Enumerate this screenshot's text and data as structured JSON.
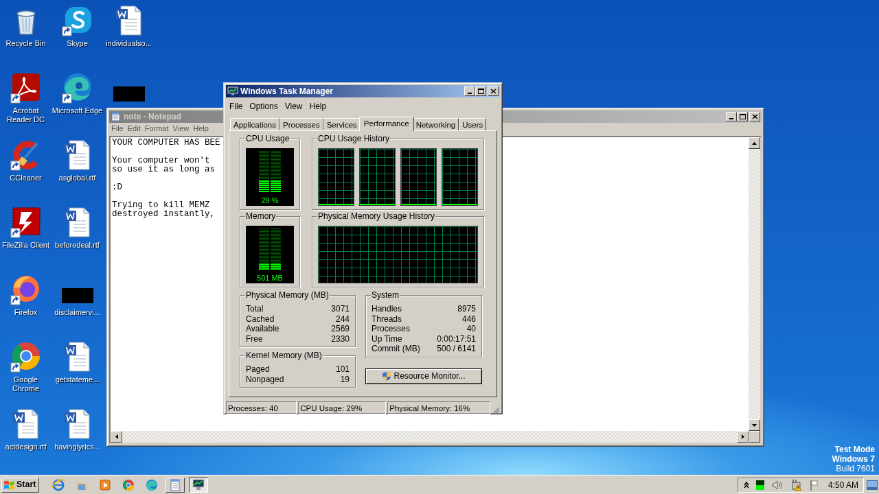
{
  "desktop": {
    "icons": [
      {
        "label": "Recycle Bin",
        "kind": "recycle",
        "shortcut": false
      },
      {
        "label": "Acrobat Reader DC",
        "kind": "acrobat",
        "shortcut": true
      },
      {
        "label": "CCleaner",
        "kind": "ccleaner",
        "shortcut": true
      },
      {
        "label": "FileZilla Client",
        "kind": "filezilla",
        "shortcut": true
      },
      {
        "label": "Firefox",
        "kind": "firefox",
        "shortcut": true
      },
      {
        "label": "Google Chrome",
        "kind": "chrome",
        "shortcut": true
      },
      {
        "label": "actdesign.rtf",
        "kind": "document",
        "shortcut": false
      },
      {
        "label": "Skype",
        "kind": "skype",
        "shortcut": true
      },
      {
        "label": "Microsoft Edge",
        "kind": "edge",
        "shortcut": true
      },
      {
        "label": "asglobal.rtf",
        "kind": "document",
        "shortcut": false
      },
      {
        "label": "beforedeal.rtf",
        "kind": "document",
        "shortcut": false
      },
      {
        "label": "disclaimervi...",
        "kind": "blacked_out",
        "shortcut": false
      },
      {
        "label": "getstateme...",
        "kind": "document",
        "shortcut": false
      },
      {
        "label": "havinglyrics...",
        "kind": "document",
        "shortcut": false
      },
      {
        "label": "individualso...",
        "kind": "document",
        "shortcut": false
      },
      {
        "kind": "blacked_out",
        "shortcut": false
      }
    ],
    "os_notice": [
      "Test Mode",
      "Windows 7",
      "Build 7601"
    ]
  },
  "notepad": {
    "title": "note - Notepad",
    "active": false,
    "menu": [
      "File",
      "Edit",
      "Format",
      "View",
      "Help"
    ],
    "paragraphs": [
      [
        "YOUR COMPUTER HAS BEE"
      ],
      [
        "Your computer won't",
        "so use it as long as"
      ],
      [
        ":D"
      ],
      [
        "Trying to kill MEMZ",
        "destroyed instantly,"
      ]
    ]
  },
  "task_manager": {
    "title": "Windows Task Manager",
    "active": true,
    "menu": [
      "File",
      "Options",
      "View",
      "Help"
    ],
    "tabs": [
      {
        "label": "Applications",
        "selected": false
      },
      {
        "label": "Processes",
        "selected": false
      },
      {
        "label": "Services",
        "selected": false
      },
      {
        "label": "Performance",
        "selected": true
      },
      {
        "label": "Networking",
        "selected": false
      },
      {
        "label": "Users",
        "selected": false
      }
    ],
    "cpu_usage": {
      "label": "CPU Usage",
      "level": 0.29,
      "reading": "29 %"
    },
    "cpu_usage_history": {
      "label": "CPU Usage History"
    },
    "memory": {
      "label": "Memory",
      "level": 0.16,
      "reading": "501 MB"
    },
    "physical_memory_usage_history": {
      "label": "Physical Memory Usage History"
    },
    "physical_memory": {
      "label": "Physical Memory (MB)",
      "rows": [
        {
          "label": "Total",
          "value": "3071"
        },
        {
          "label": "Cached",
          "value": "244"
        },
        {
          "label": "Available",
          "value": "2569"
        },
        {
          "label": "Free",
          "value": "2330"
        }
      ]
    },
    "kernel_memory": {
      "label": "Kernel Memory (MB)",
      "rows": [
        {
          "label": "Paged",
          "value": "101"
        },
        {
          "label": "Nonpaged",
          "value": "19"
        }
      ]
    },
    "system": {
      "label": "System",
      "rows": [
        {
          "label": "Handles",
          "value": "8975"
        },
        {
          "label": "Threads",
          "value": "446"
        },
        {
          "label": "Processes",
          "value": "40"
        },
        {
          "label": "Up Time",
          "value": "0:00:17:51"
        },
        {
          "label": "Commit (MB)",
          "value": "500 / 6141"
        }
      ]
    },
    "resource_monitor_button": "Resource Monitor...",
    "status_bar": [
      "Processes: 40",
      "CPU Usage: 29%",
      "Physical Memory: 16%"
    ]
  },
  "taskbar": {
    "start": "Start",
    "items": [
      {
        "kind": "ie",
        "running": false
      },
      {
        "kind": "folder",
        "running": false
      },
      {
        "kind": "media",
        "running": false
      },
      {
        "kind": "chrome",
        "running": false
      },
      {
        "kind": "edge",
        "running": false
      },
      {
        "kind": "notepad",
        "running": true,
        "selected": false
      },
      {
        "kind": "taskmgr",
        "running": true,
        "selected": true
      }
    ],
    "clock": "4:50 AM"
  }
}
